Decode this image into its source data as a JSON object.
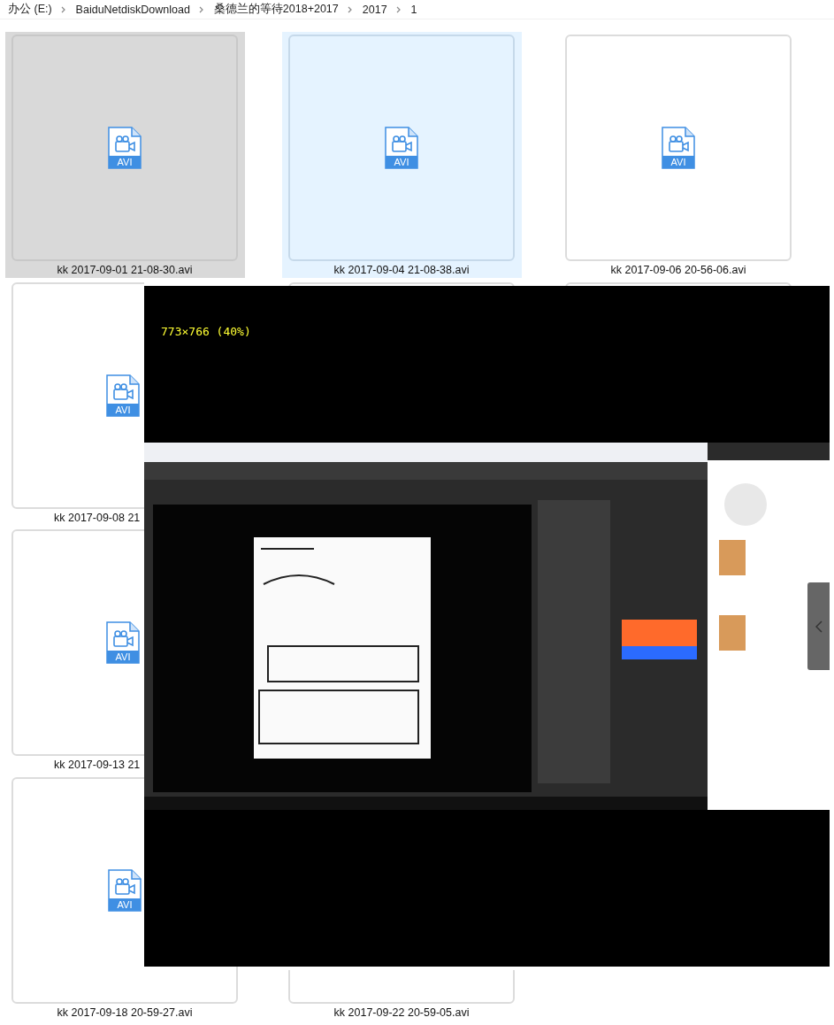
{
  "breadcrumb": [
    "办公 (E:)",
    "BaiduNetdiskDownload",
    "桑德兰的等待2018+2017",
    "2017",
    "1"
  ],
  "files": [
    {
      "kind": "full",
      "label": "kk 2017-09-01 21-08-30.avi",
      "badge": "AVI",
      "selected": true,
      "hovered": false
    },
    {
      "kind": "full",
      "label": "kk 2017-09-04 21-08-38.avi",
      "badge": "AVI",
      "selected": false,
      "hovered": true
    },
    {
      "kind": "full",
      "label": "kk 2017-09-06 20-56-06.avi",
      "badge": "AVI",
      "selected": false,
      "hovered": false
    },
    {
      "kind": "cut-right",
      "label": "kk 2017-09-08 21",
      "badge": "AVI",
      "selected": false,
      "hovered": false
    },
    {
      "kind": "top-strip",
      "selected": false,
      "hovered": false
    },
    {
      "kind": "top-strip",
      "selected": false,
      "hovered": false
    },
    {
      "kind": "cut-right",
      "label": "kk 2017-09-13 21",
      "badge": "AVI",
      "selected": false,
      "hovered": false
    },
    {
      "kind": "blank"
    },
    {
      "kind": "blank"
    },
    {
      "kind": "full",
      "label": "kk 2017-09-18 20-59-27.avi",
      "badge": "AVI",
      "selected": false,
      "hovered": false
    },
    {
      "kind": "bottom-strip",
      "label": "kk 2017-09-22 20-59-05.avi",
      "selected": false,
      "hovered": false
    }
  ],
  "preview": {
    "size_info": "773×766 (40%)"
  }
}
